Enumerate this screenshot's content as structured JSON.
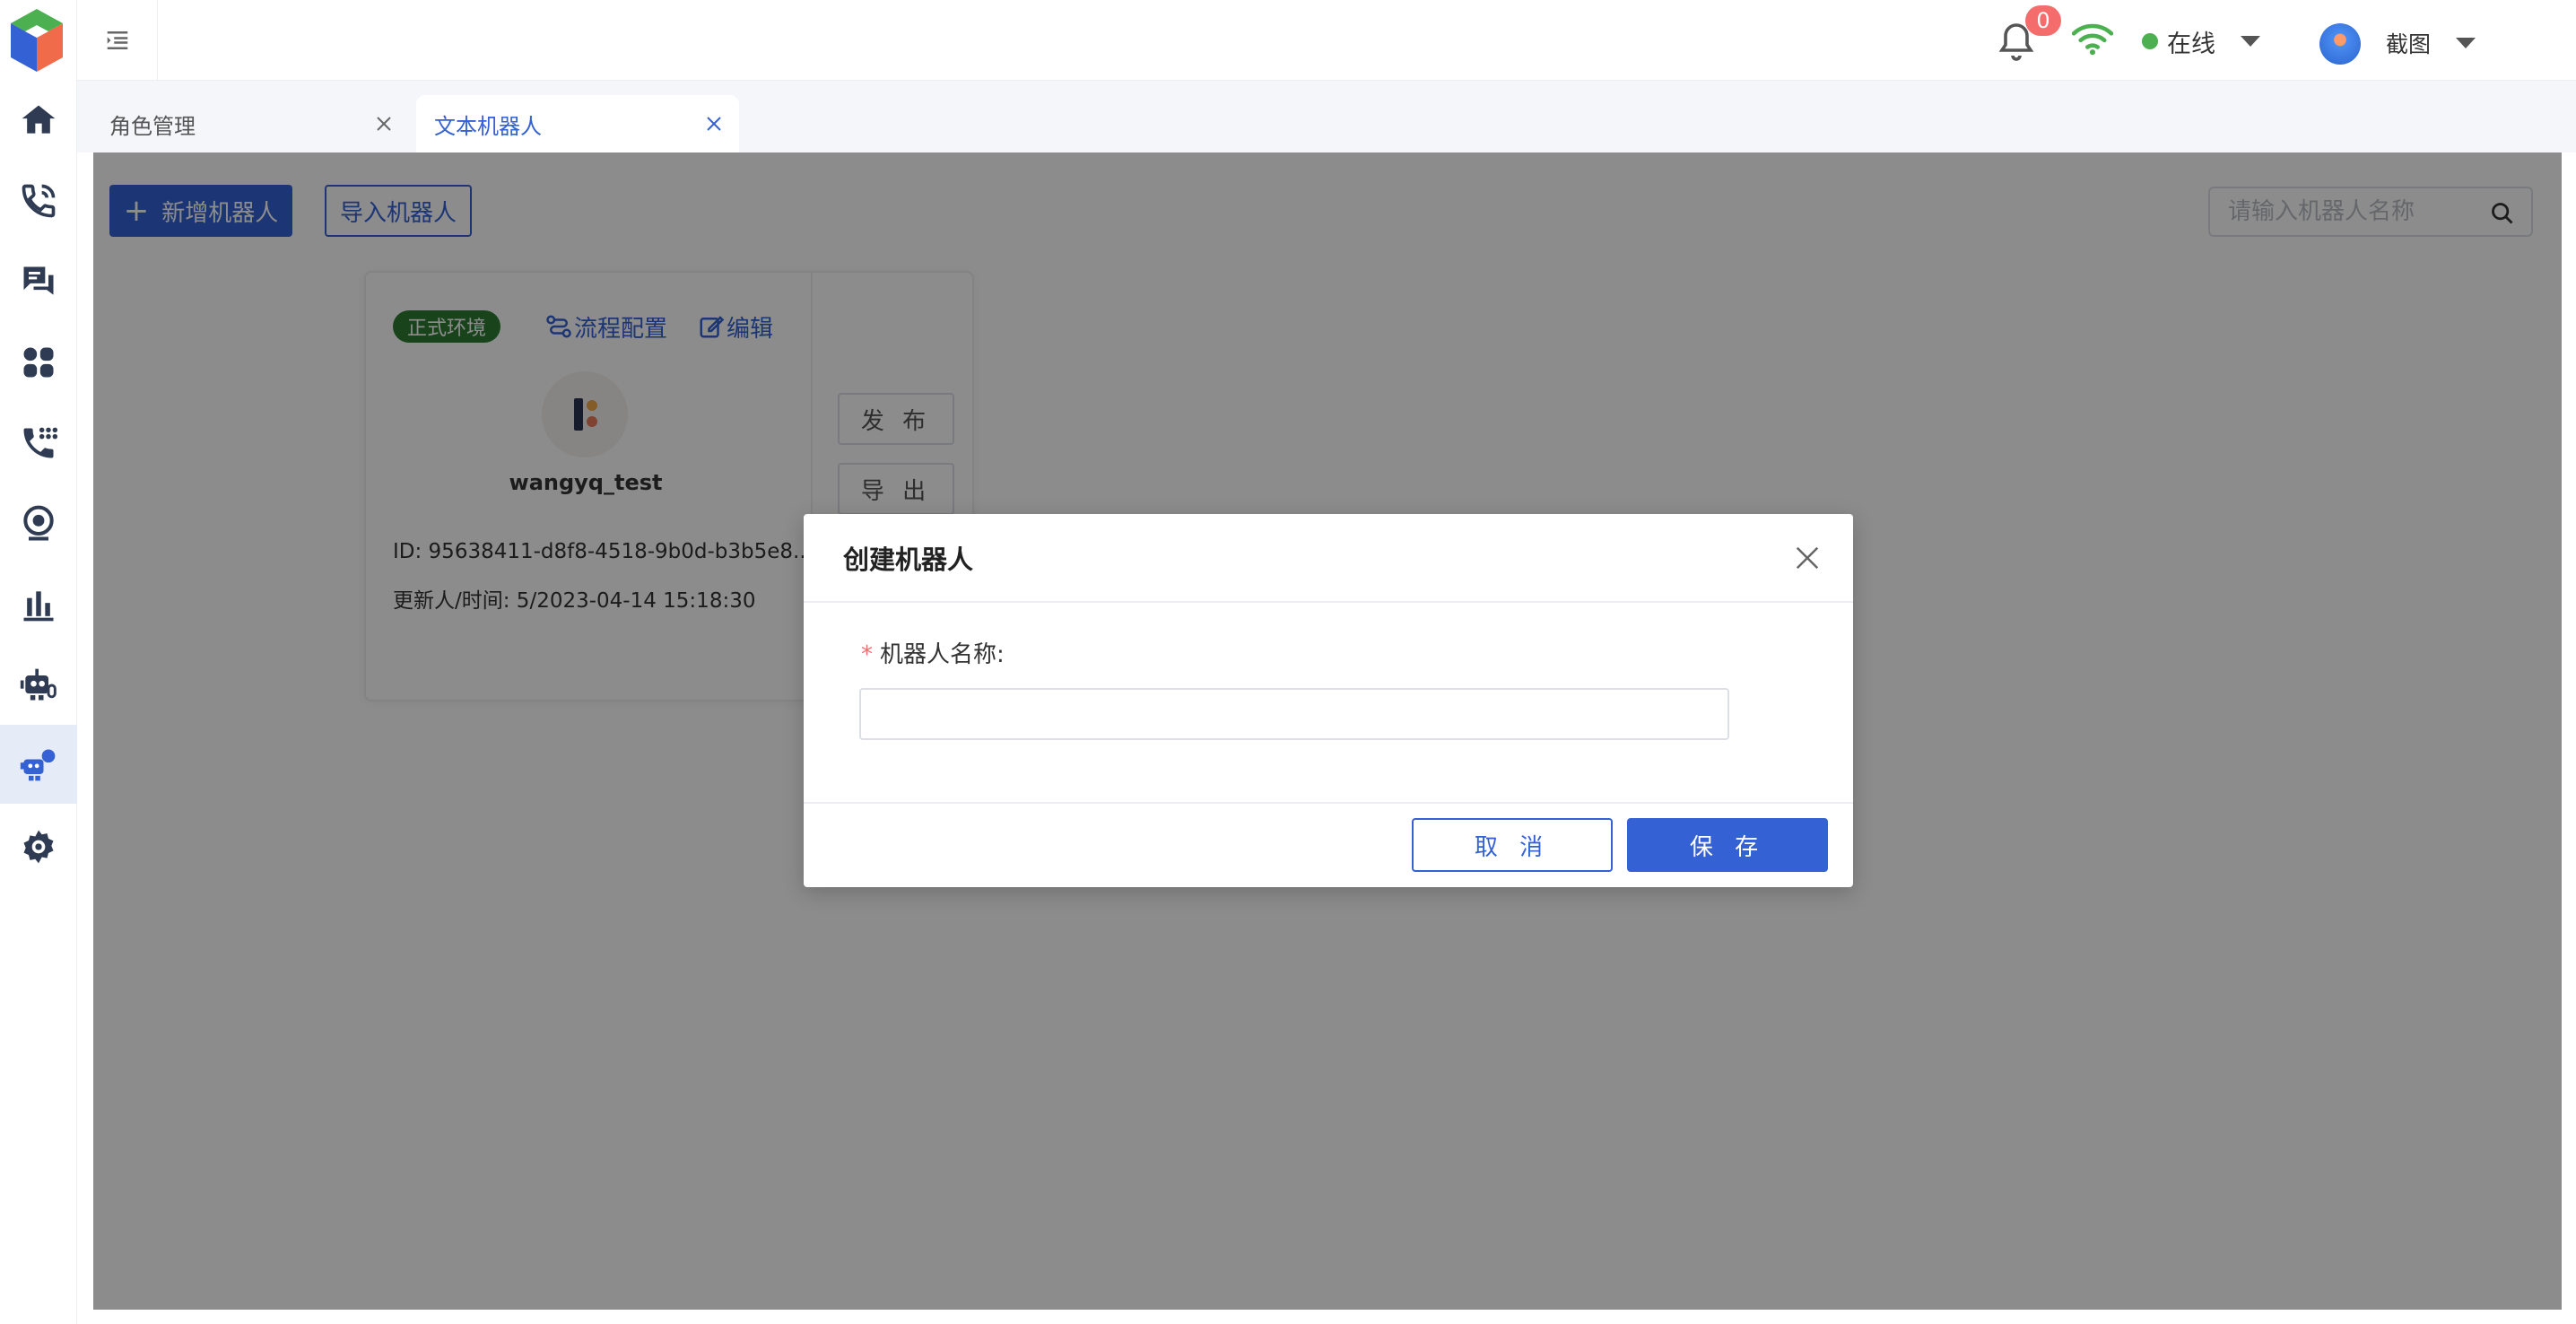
{
  "colors": {
    "accent": "#3461d4",
    "success": "#2e7d32",
    "danger": "#f56c6c",
    "online": "#4caf50"
  },
  "sidebar": {
    "items": [
      {
        "icon": "home-icon"
      },
      {
        "icon": "phone-call-icon"
      },
      {
        "icon": "chat-messages-icon"
      },
      {
        "icon": "apps-grid-icon"
      },
      {
        "icon": "phone-dialpad-icon"
      },
      {
        "icon": "monitor-target-icon"
      },
      {
        "icon": "bar-chart-icon"
      },
      {
        "icon": "robot-icon"
      },
      {
        "icon": "text-robot-icon",
        "active": true
      },
      {
        "icon": "settings-gear-icon"
      }
    ]
  },
  "header": {
    "notification_count": "0",
    "status": "在线",
    "user_name": "截图"
  },
  "tabs": [
    {
      "label": "角色管理",
      "active": false
    },
    {
      "label": "文本机器人",
      "active": true
    }
  ],
  "toolbar": {
    "add_label": "新增机器人",
    "import_label": "导入机器人",
    "search_placeholder": "请输入机器人名称"
  },
  "card": {
    "env_tag": "正式环境",
    "flow_label": "流程配置",
    "edit_label": "编辑",
    "name": "wangyq_test",
    "id_text": "ID: 95638411-d8f8-4518-9b0d-b3b5e8...",
    "update_text": "更新人/时间: 5/2023-04-14 15:18:30",
    "publish_label": "发 布",
    "export_label": "导 出"
  },
  "modal": {
    "title": "创建机器人",
    "field_label": "机器人名称:",
    "field_value": "",
    "cancel_label": "取 消",
    "save_label": "保 存"
  }
}
